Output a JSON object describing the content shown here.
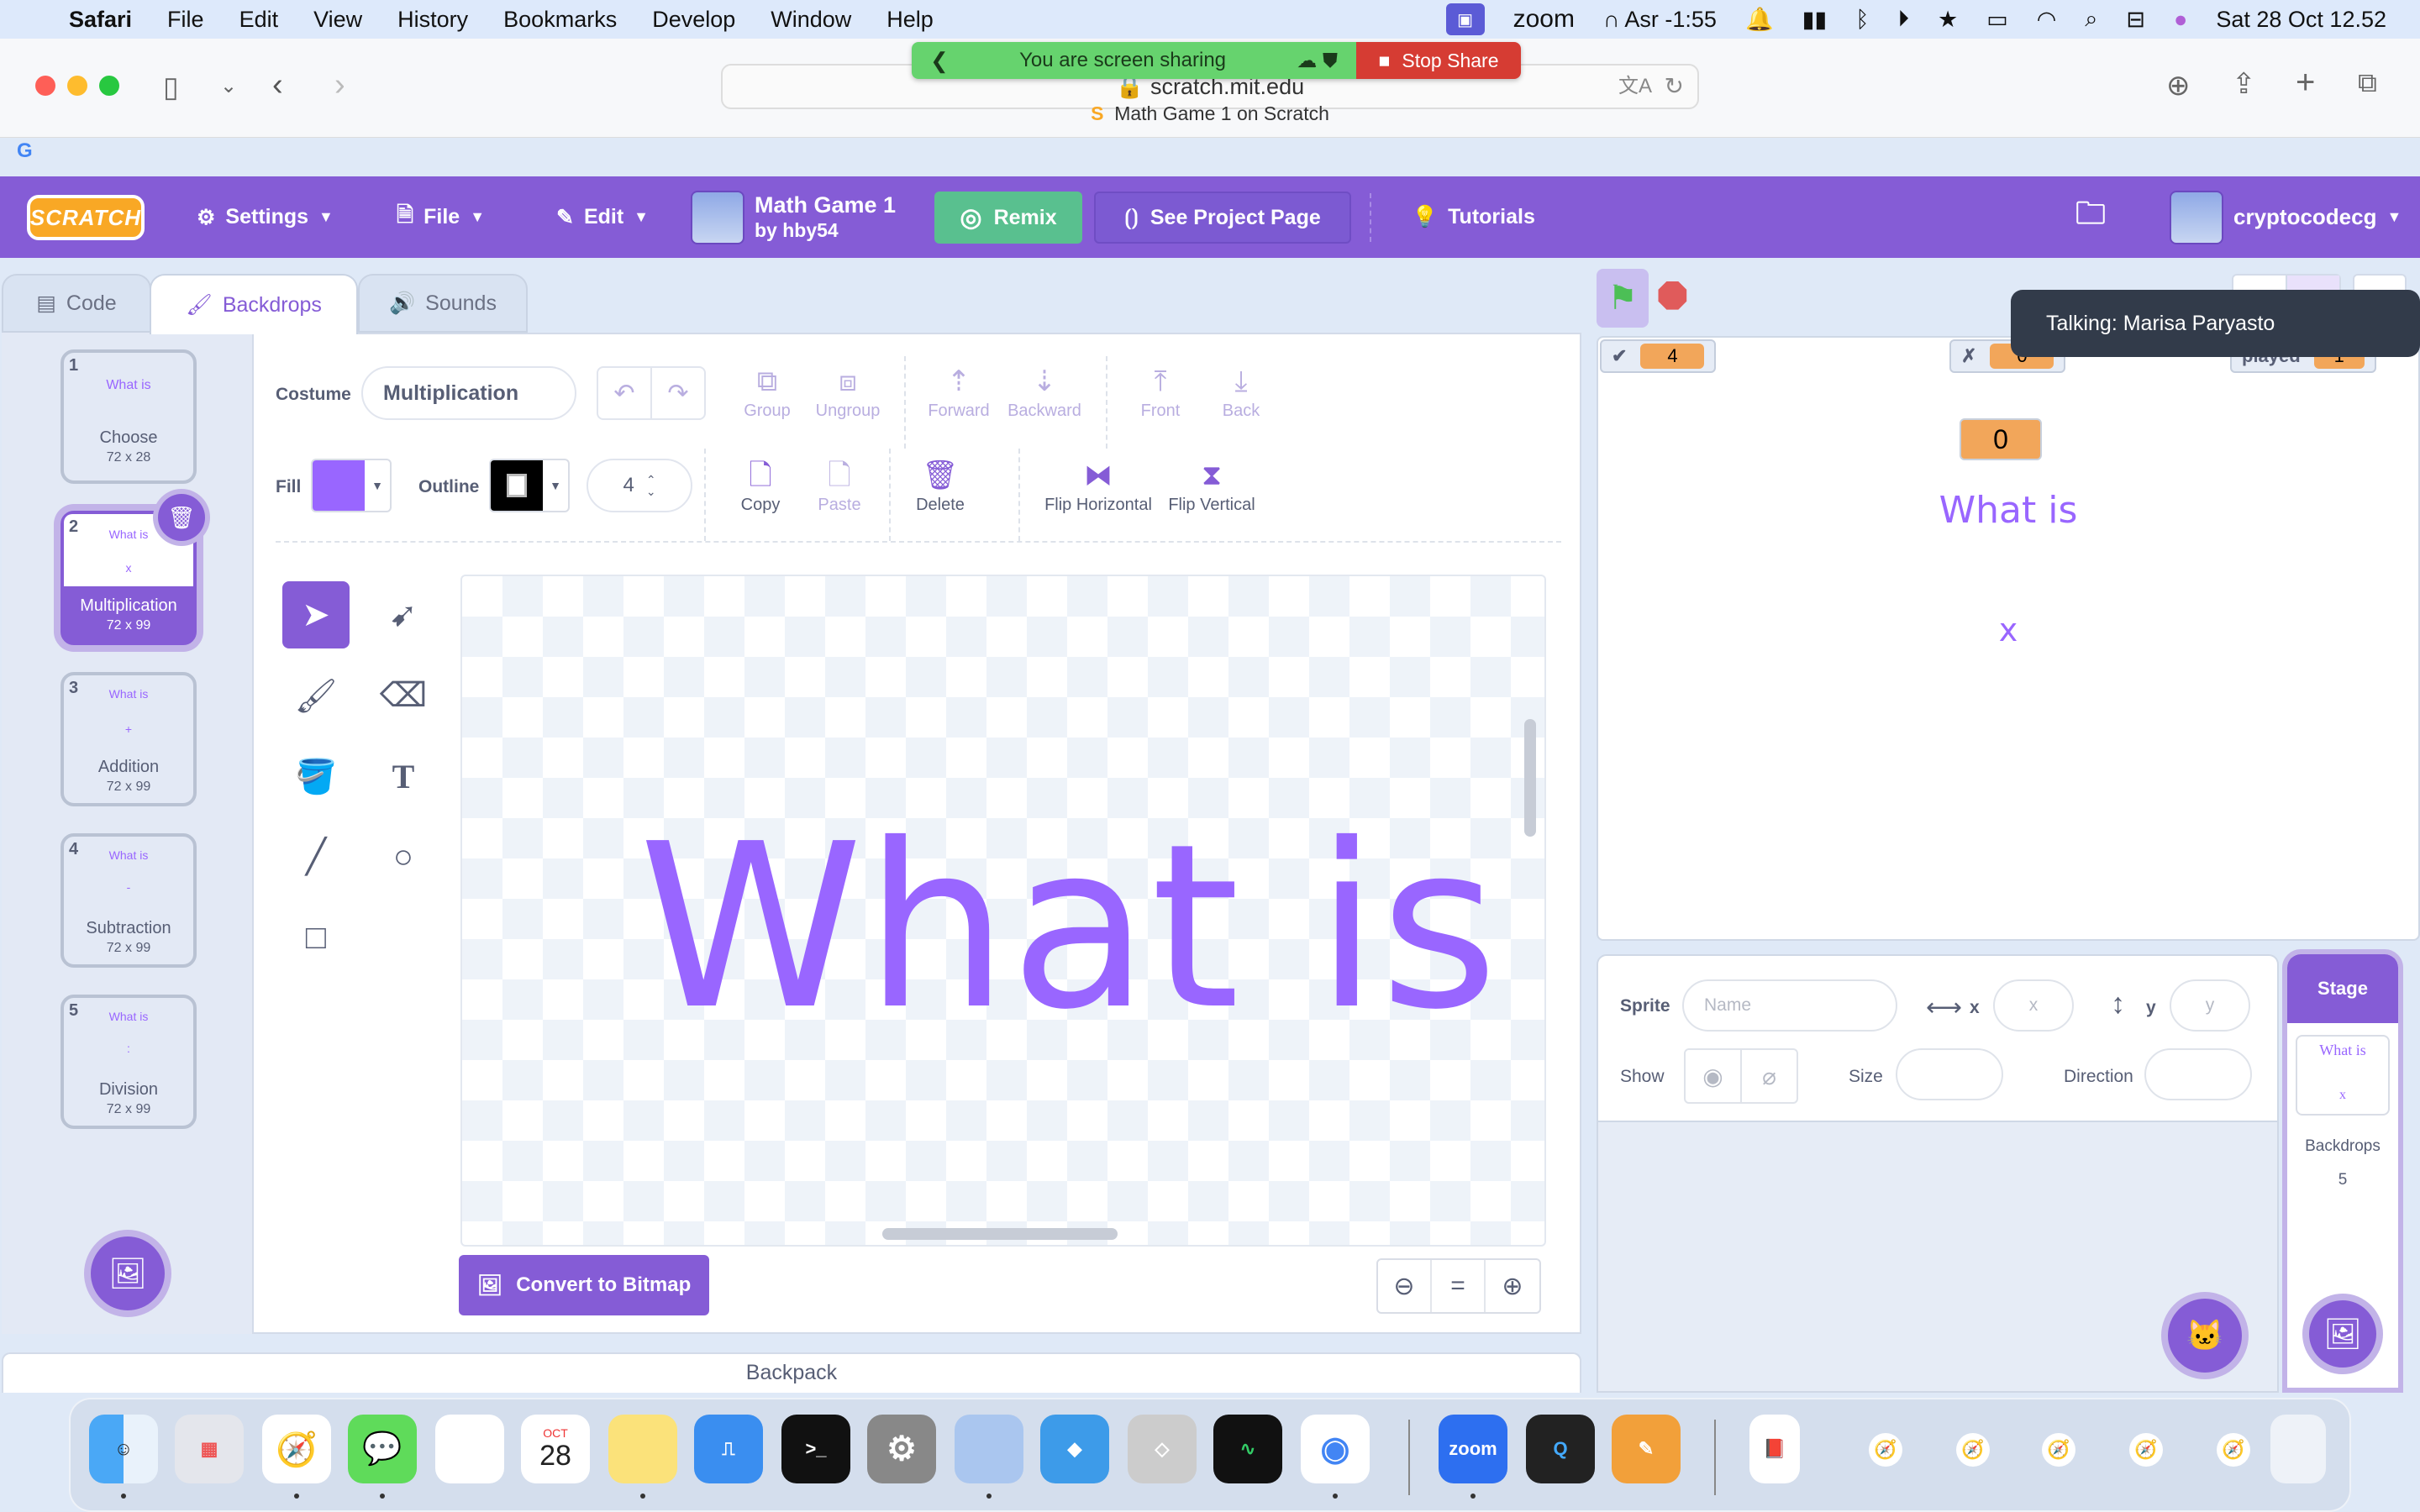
{
  "menubar": {
    "app": "Safari",
    "items": [
      "File",
      "Edit",
      "View",
      "History",
      "Bookmarks",
      "Develop",
      "Window",
      "Help"
    ],
    "status": {
      "zoom_label": "zoom",
      "prayer": "Asr -1:55",
      "datetime": "Sat 28 Oct  12.52"
    }
  },
  "browser": {
    "url": "scratch.mit.edu",
    "tab_title": "Math Game 1 on Scratch",
    "share_bar": {
      "text": "You are screen sharing",
      "stop_label": "Stop Share"
    }
  },
  "scratch_menu": {
    "logo": "SCRATCH",
    "settings": "Settings",
    "file": "File",
    "edit": "Edit",
    "project_title": "Math Game 1",
    "project_author": "by hby54",
    "remix": "Remix",
    "see_project": "See Project Page",
    "tutorials": "Tutorials",
    "username": "cryptocodecg"
  },
  "tabs": [
    {
      "label": "Code",
      "active": false
    },
    {
      "label": "Backdrops",
      "active": true
    },
    {
      "label": "Sounds",
      "active": false
    }
  ],
  "backdrops": [
    {
      "num": "1",
      "preview": "What is",
      "op": "",
      "name": "Choose",
      "size": "72 x 28",
      "selected": false
    },
    {
      "num": "2",
      "preview": "What is",
      "op": "x",
      "name": "Multiplication",
      "size": "72 x 99",
      "selected": true
    },
    {
      "num": "3",
      "preview": "What is",
      "op": "+",
      "name": "Addition",
      "size": "72 x 99",
      "selected": false
    },
    {
      "num": "4",
      "preview": "What is",
      "op": "-",
      "name": "Subtraction",
      "size": "72 x 99",
      "selected": false
    },
    {
      "num": "5",
      "preview": "What is",
      "op": ":",
      "name": "Division",
      "size": "72 x 99",
      "selected": false
    }
  ],
  "paint_editor": {
    "costume_label": "Costume",
    "costume_name": "Multiplication",
    "fill_label": "Fill",
    "fill_color": "#9966ff",
    "outline_label": "Outline",
    "outline_color": "#000000",
    "outline_width": "4",
    "toolbar_row1": [
      "Group",
      "Ungroup",
      "Forward",
      "Backward",
      "Front",
      "Back"
    ],
    "toolbar_row2": [
      "Copy",
      "Paste",
      "Delete",
      "Flip Horizontal",
      "Flip Vertical"
    ],
    "canvas_text": "What is",
    "convert_label": "Convert to Bitmap",
    "zoom_reset": "="
  },
  "backpack_label": "Backpack",
  "stage": {
    "monitors": [
      {
        "label": "✔",
        "value": "4"
      },
      {
        "label": "✗",
        "value": "0"
      },
      {
        "label": "played",
        "value": "1"
      }
    ],
    "score_value": "0",
    "question_text": "What is",
    "operator_text": "x",
    "talking_tooltip": "Talking: Marisa Paryasto"
  },
  "sprite_info": {
    "sprite_label": "Sprite",
    "name_placeholder": "Name",
    "x_label": "x",
    "x_placeholder": "x",
    "y_label": "y",
    "y_placeholder": "y",
    "show_label": "Show",
    "size_label": "Size",
    "direction_label": "Direction"
  },
  "stage_pane": {
    "title": "Stage",
    "thumb_line1": "What is",
    "thumb_line2": "x",
    "backdrops_label": "Backdrops",
    "backdrops_count": "5"
  },
  "dock": {
    "calendar_month": "OCT",
    "calendar_day": "28",
    "zoom_label": "zoom"
  }
}
